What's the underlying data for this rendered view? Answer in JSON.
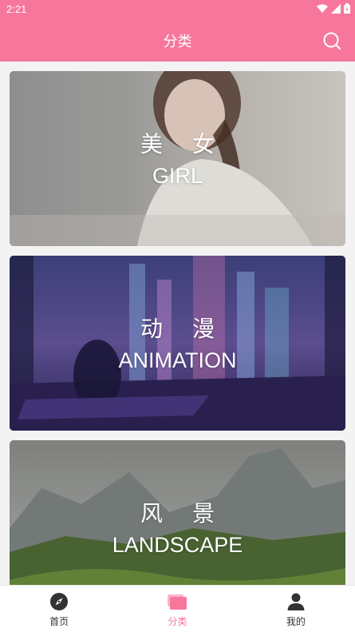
{
  "status_bar": {
    "time": "2:21",
    "icons": [
      "wifi-icon",
      "signal-icon",
      "battery-icon"
    ]
  },
  "header": {
    "title": "分类",
    "search_icon": "search-icon"
  },
  "colors": {
    "accent": "#f7779c",
    "nav_inactive": "#333333"
  },
  "categories": [
    {
      "cn": "美 女",
      "en": "GIRL"
    },
    {
      "cn": "动 漫",
      "en": "ANIMATION"
    },
    {
      "cn": "风 景",
      "en": "LANDSCAPE"
    }
  ],
  "bottom_nav": [
    {
      "label": "首页",
      "icon": "compass-icon",
      "active": false
    },
    {
      "label": "分类",
      "icon": "cards-icon",
      "active": true
    },
    {
      "label": "我的",
      "icon": "person-icon",
      "active": false
    }
  ]
}
